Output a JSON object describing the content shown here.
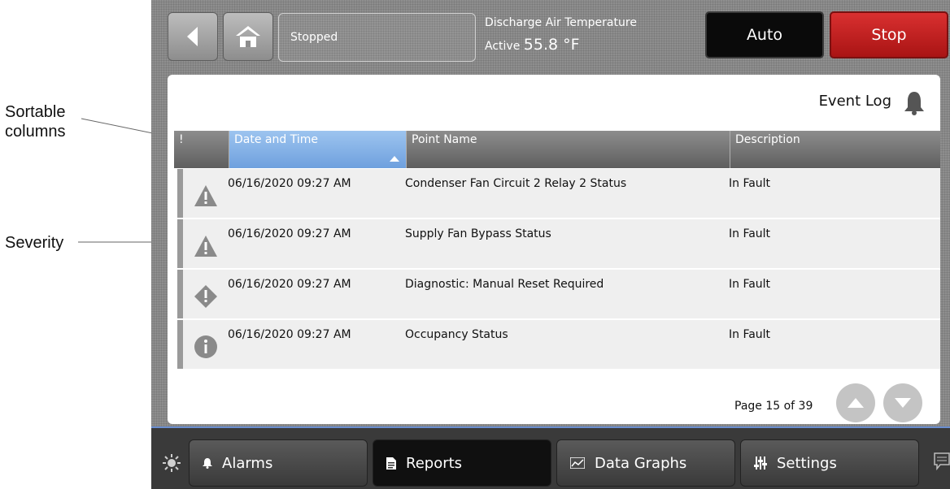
{
  "annotations": {
    "sortable_columns": "Sortable\ncolumns",
    "severity": "Severity"
  },
  "topbar": {
    "status": "Stopped",
    "temperature_label": "Discharge Air Temperature",
    "temperature_state": "Active",
    "temperature_value": "55.8 °F",
    "auto_label": "Auto",
    "stop_label": "Stop",
    "colors": {
      "stop": "#c02020",
      "auto": "#0a0a0a"
    }
  },
  "panel": {
    "title": "Event Log",
    "columns": [
      "!",
      "Date and Time",
      "Point Name",
      "Description"
    ],
    "sorted_column": "Date and Time",
    "rows": [
      {
        "severity": "warning-triangle-icon",
        "datetime": "06/16/2020 09:27 AM",
        "point": "Condenser Fan Circuit 2 Relay 2 Status",
        "description": "In Fault"
      },
      {
        "severity": "warning-triangle-icon",
        "datetime": "06/16/2020 09:27 AM",
        "point": "Supply Fan Bypass Status",
        "description": "In Fault"
      },
      {
        "severity": "diamond-alert-icon",
        "datetime": "06/16/2020 09:27 AM",
        "point": "Diagnostic: Manual Reset Required",
        "description": "In Fault"
      },
      {
        "severity": "info-circle-icon",
        "datetime": "06/16/2020 09:27 AM",
        "point": "Occupancy Status",
        "description": "In Fault"
      }
    ],
    "page_label": "Page 15 of 39"
  },
  "nav": {
    "items": [
      {
        "label": "Alarms",
        "icon": "bell-icon"
      },
      {
        "label": "Reports",
        "icon": "document-icon"
      },
      {
        "label": "Data Graphs",
        "icon": "graph-icon"
      },
      {
        "label": "Settings",
        "icon": "sliders-icon"
      }
    ],
    "active": "Reports"
  }
}
